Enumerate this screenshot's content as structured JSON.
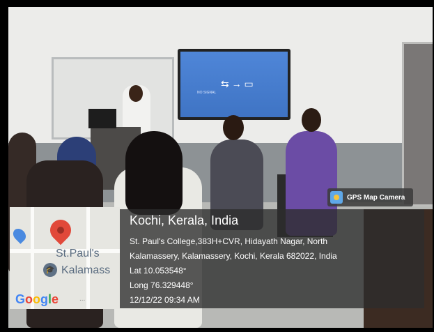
{
  "gps_badge": {
    "icon": "camera-icon",
    "label": "GPS Map Camera"
  },
  "location": {
    "title": "Kochi, Kerala, India",
    "address_line_1": "St. Paul's College,383H+CVR, Hidayath Nagar, North",
    "address_line_2": "Kalamassery, Kalamassery, Kochi, Kerala 682022, India",
    "latitude": "Lat 10.053548°",
    "longitude": "Long 76.329448°",
    "timestamp": "12/12/22 09:34 AM"
  },
  "map": {
    "place_label_1": "St.Paul's",
    "place_label_2": "Kalamass",
    "brand": "Google",
    "brand_colors": [
      "#4285F4",
      "#EA4335",
      "#FBBC05",
      "#4285F4",
      "#34A853",
      "#EA4335"
    ],
    "more": "..."
  },
  "tv_screen": {
    "text": "NO SIGNAL"
  }
}
